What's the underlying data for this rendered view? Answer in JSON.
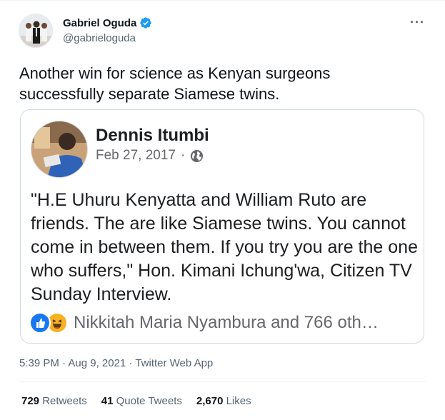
{
  "tweet": {
    "author_name": "Gabriel Oguda",
    "author_handle": "@gabrieloguda",
    "more_label": "···",
    "text": "Another win for science as Kenyan surgeons successfully separate Siamese twins.",
    "timestamp": "5:39 PM · Aug 9, 2021 · Twitter Web App",
    "verified_color": "#1d9bf0",
    "brand_color": "#1d9bf0"
  },
  "quoted_post": {
    "author_name": "Dennis Itumbi",
    "date": "Feb 27, 2017",
    "separator": "·",
    "privacy_icon": "globe-icon",
    "text": "\"H.E Uhuru Kenyatta and William Ruto are friends. The are like Siamese twins. You cannot come in between them. If you try you are the one who suffers,\" Hon. Kimani Ichung'wa, Citizen TV Sunday Interview.",
    "reactions_text": "Nikkitah Maria Nyambura and 766 oth…",
    "reaction_icons": [
      "like-icon",
      "haha-icon"
    ]
  },
  "stats": {
    "retweets_count": "729",
    "retweets_label": "Retweets",
    "quote_tweets_count": "41",
    "quote_tweets_label": "Quote Tweets",
    "likes_count": "2,670",
    "likes_label": "Likes"
  }
}
